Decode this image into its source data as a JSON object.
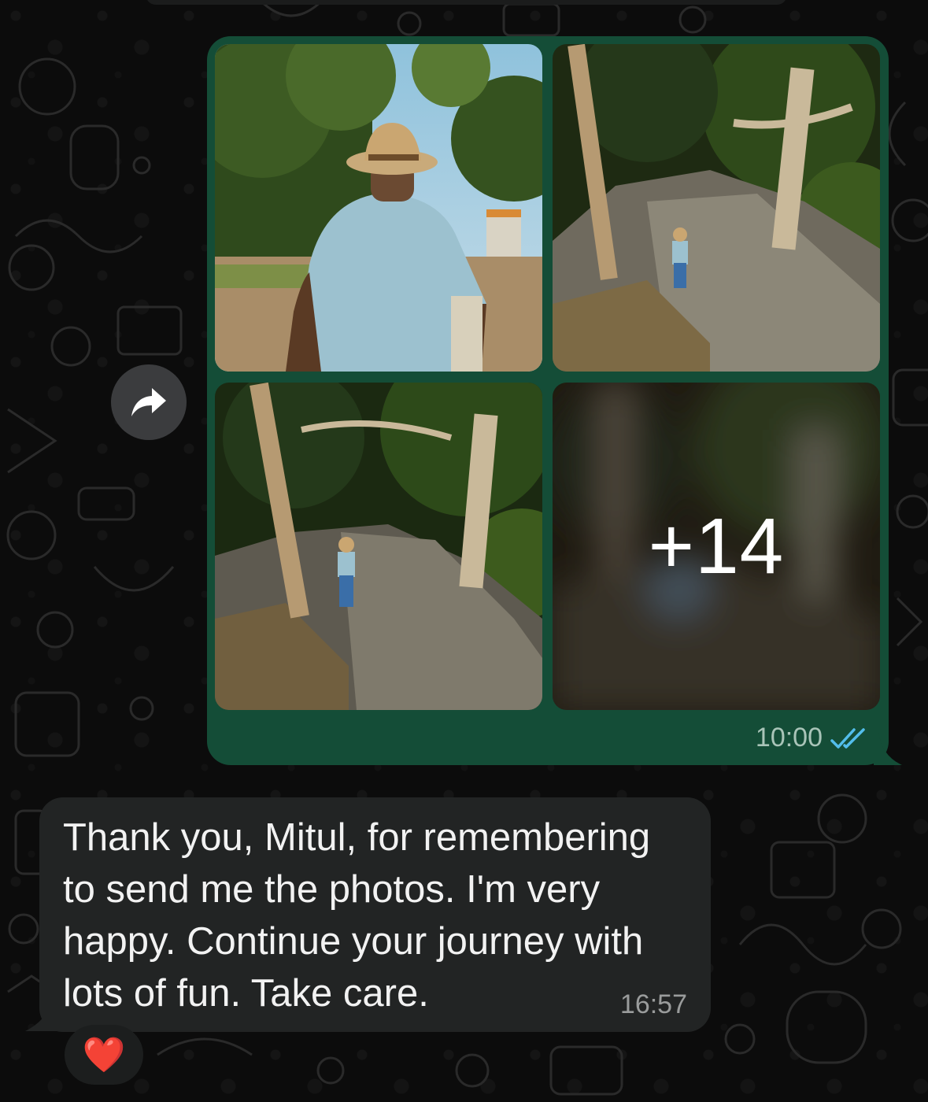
{
  "outgoing_message": {
    "extra_photos_label": "+14",
    "time": "10:00",
    "read_status_icon": "double-check-read-icon",
    "photos": [
      {
        "description_icon": "photo-man-with-hat-icon"
      },
      {
        "description_icon": "photo-forest-rocks-icon"
      },
      {
        "description_icon": "photo-forest-rocks-icon"
      },
      {
        "description_icon": "photo-blurred-icon"
      }
    ]
  },
  "forward_button": {
    "icon": "forward-arrow-icon"
  },
  "incoming_message": {
    "text": "Thank you, Mitul, for remembering to send me the photos. I'm very happy. Continue your journey with lots of fun. Take care.",
    "lines": [
      "Thank you, Mitul, for remembering",
      "to send me the photos. I'm very",
      "happy. Continue your journey with",
      "lots of fun. Take care."
    ],
    "time": "16:57",
    "reaction": "❤️"
  },
  "colors": {
    "background": "#0c0c0c",
    "outgoing_bubble": "#144d37",
    "incoming_bubble": "#222424",
    "read_ticks": "#53bdeb"
  }
}
